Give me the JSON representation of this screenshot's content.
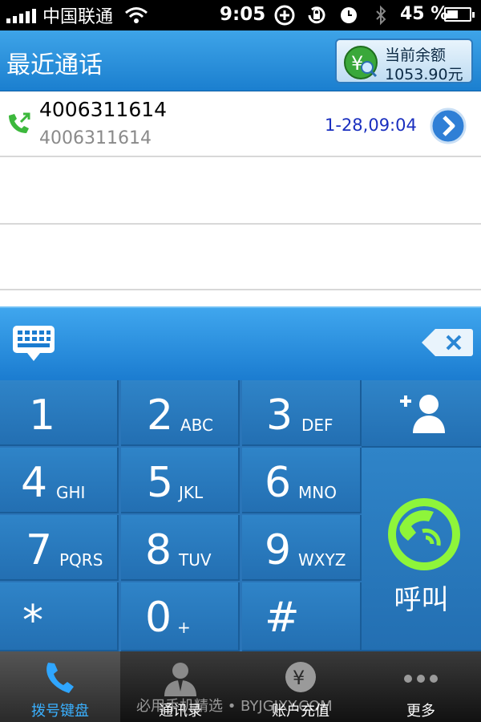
{
  "status_bar": {
    "carrier": "中国联通",
    "time": "9:05",
    "battery_percent": "45 %"
  },
  "header": {
    "title": "最近通话",
    "balance_label": "当前余额",
    "balance_value": "1053.90元"
  },
  "calls": [
    {
      "number": "4006311614",
      "sub": "4006311614",
      "time": "1-28,09:04"
    }
  ],
  "keypad": {
    "keys": [
      {
        "digit": "1",
        "letters": ""
      },
      {
        "digit": "2",
        "letters": "ABC"
      },
      {
        "digit": "3",
        "letters": "DEF"
      },
      {
        "digit": "4",
        "letters": "GHI"
      },
      {
        "digit": "5",
        "letters": "JKL"
      },
      {
        "digit": "6",
        "letters": "MNO"
      },
      {
        "digit": "7",
        "letters": "PQRS"
      },
      {
        "digit": "8",
        "letters": "TUV"
      },
      {
        "digit": "9",
        "letters": "WXYZ"
      },
      {
        "digit": "*",
        "letters": ""
      },
      {
        "digit": "0",
        "letters": "+"
      },
      {
        "digit": "#",
        "letters": ""
      }
    ],
    "call_label": "呼叫"
  },
  "tabs": [
    {
      "label": "拨号键盘",
      "icon": "phone-icon",
      "active": true
    },
    {
      "label": "通讯录",
      "icon": "contacts-icon",
      "active": false
    },
    {
      "label": "账户充值",
      "icon": "yuan-icon",
      "active": false
    },
    {
      "label": "更多",
      "icon": "more-icon",
      "active": false
    }
  ],
  "watermark": "必用手机精选 • BYJGJXY.COM",
  "colors": {
    "header_blue": "#1b7fcf",
    "keypad_blue": "#2a75b8",
    "call_green": "#7ee62c",
    "time_blue": "#1a2fbf",
    "active_tab": "#3ab0ff"
  }
}
